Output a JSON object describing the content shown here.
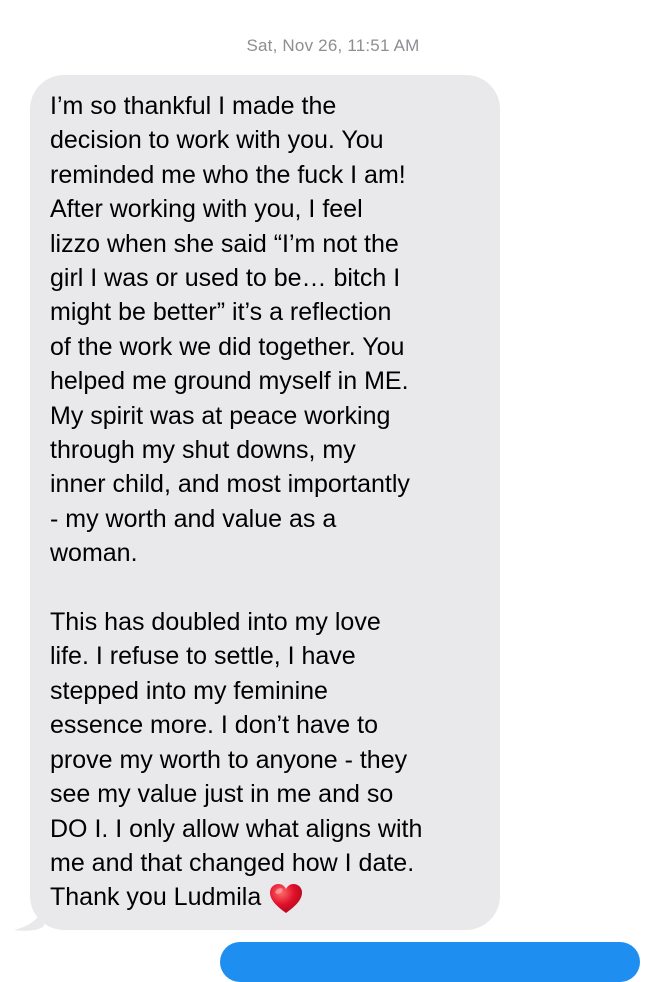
{
  "thread": {
    "timestamp": "Sat, Nov 26, 11:51 AM"
  },
  "message": {
    "paragraph1": [
      "I’m so thankful I made the",
      "decision to work with you. You",
      "reminded me who the fuck I am!",
      "After working with you, I feel",
      "lizzo when she said “I’m not the",
      "girl I was or used to be… bitch I",
      "might be better” it’s a reflection",
      "of the work we did together. You",
      "helped me ground myself in ME.",
      "My spirit was at peace working",
      "through my shut downs, my",
      "inner child, and most importantly",
      "- my worth and value as a",
      "woman."
    ],
    "paragraph2": [
      "This has doubled into my love",
      "life. I refuse to settle, I have",
      "stepped into my feminine",
      "essence more. I don’t have to",
      "prove my worth to anyone - they",
      "see my value just in me and so",
      "DO I. I only allow what aligns with",
      "me and that changed how I date."
    ],
    "closing": "Thank you Ludmila",
    "emoji_icon": "red-heart-icon"
  },
  "colors": {
    "bubble_received": "#e9e9eb",
    "timestamp_text": "#8e8e93",
    "heart": "#e0102a",
    "next_bubble_sent": "#1f8ef1"
  }
}
